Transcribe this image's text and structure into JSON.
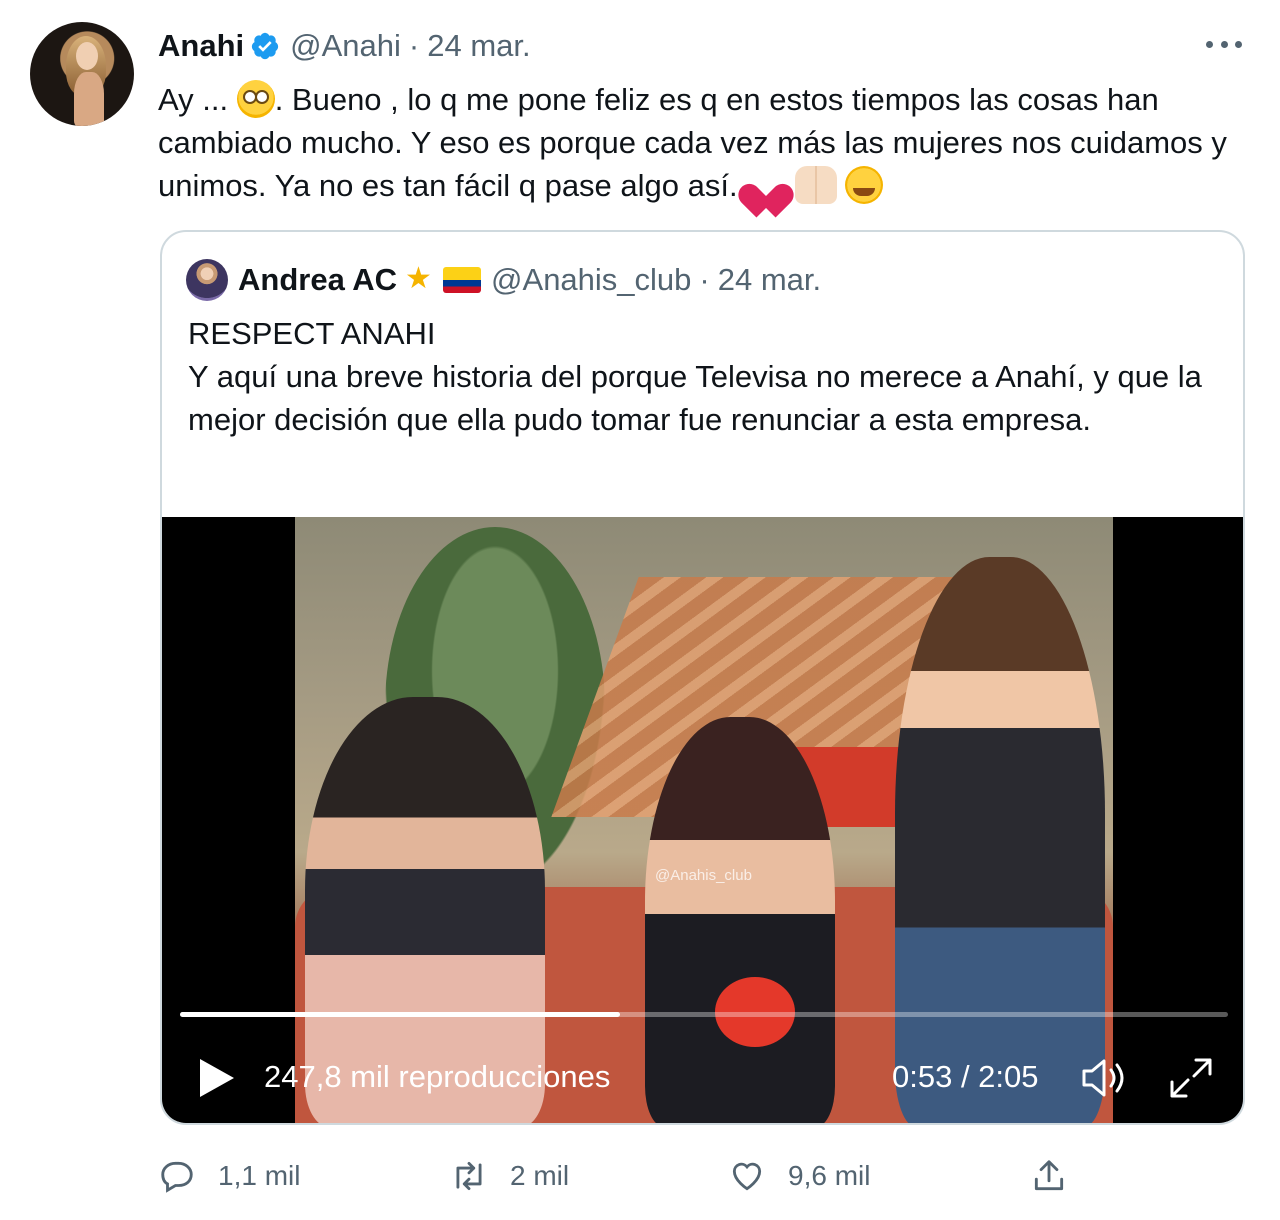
{
  "tweet": {
    "author_name": "Anahi",
    "handle": "@Anahi",
    "separator": "·",
    "date": "24 mar.",
    "text_part1": "Ay ... ",
    "text_part2": ". Bueno , lo q me pone feliz es q en estos tiempos las cosas han cambiado mucho. Y eso es porque cada vez más las mujeres nos cuidamos y unimos. Ya no es tan fácil q pase algo así. ",
    "emoji_1": "face-with-rolling-eyes",
    "emoji_2": "sparkling-heart",
    "emoji_3": "raising-hands",
    "emoji_4": "smiling-face-with-hearts"
  },
  "quoted_tweet": {
    "author_name": "Andrea AC",
    "handle": "@Anahis_club",
    "separator": "·",
    "date": "24 mar.",
    "line1": "RESPECT ANAHI",
    "line2": "Y aquí una breve historia del porque Televisa no merece a Anahí, y que la mejor decisión que ella pudo tomar fue renunciar a esta empresa."
  },
  "video": {
    "views": "247,8 mil reproducciones",
    "time": "0:53 / 2:05",
    "progress": 0.42,
    "watermark": "@Anahis_club"
  },
  "actions": {
    "reply_count": "1,1 mil",
    "retweet_count": "2 mil",
    "like_count": "9,6 mil"
  },
  "colors": {
    "verified": "#1d9bf0",
    "muted": "#536471",
    "border": "#cfd9de"
  }
}
